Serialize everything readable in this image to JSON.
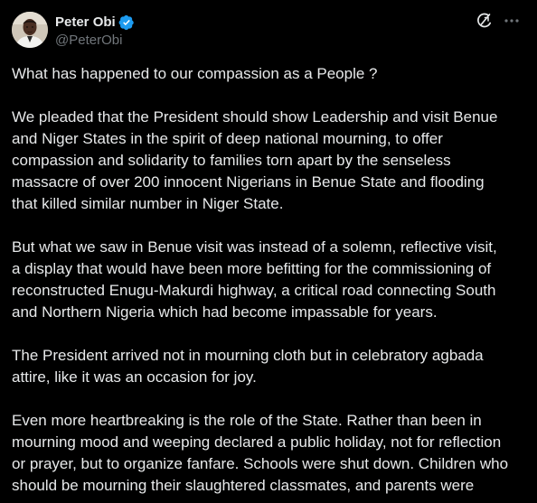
{
  "author": {
    "display_name": "Peter Obi",
    "handle": "@PeterObi",
    "verified_icon": "verified-badge-icon",
    "avatar_icon": "avatar"
  },
  "actions": {
    "grok_icon": "grok-icon",
    "more_icon": "more-options-icon"
  },
  "colors": {
    "background": "#000000",
    "text": "#e7e9ea",
    "secondary_text": "#71767b",
    "verified": "#1d9bf0"
  },
  "paragraphs": [
    {
      "lines": [
        "What has happened to our compassion as a People ?"
      ]
    },
    {
      "lines": [
        "We pleaded that the President should show Leadership and visit Benue",
        "and Niger States in the spirit of deep national mourning, to offer",
        "compassion and solidarity to families torn apart by the senseless",
        "massacre of over 200 innocent Nigerians in Benue State and flooding",
        "that killed similar number in Niger State."
      ]
    },
    {
      "lines": [
        "But what we saw in Benue visit was instead of a solemn, reflective visit,",
        "a display that would have been more befitting for the commissioning of",
        "reconstructed Enugu-Makurdi highway, a critical road connecting South",
        "and Northern Nigeria which had become impassable for years."
      ]
    },
    {
      "lines": [
        "The President arrived not in mourning cloth but in celebratory agbada",
        "attire, like it was an occasion for joy."
      ]
    },
    {
      "lines": [
        "Even more heartbreaking is the role of the State. Rather than been in",
        "mourning mood and weeping declared a public holiday, not for reflection",
        "or prayer, but to organize fanfare. Schools were shut down. Children who",
        "should be mourning their slaughtered classmates, and parents were"
      ]
    }
  ]
}
